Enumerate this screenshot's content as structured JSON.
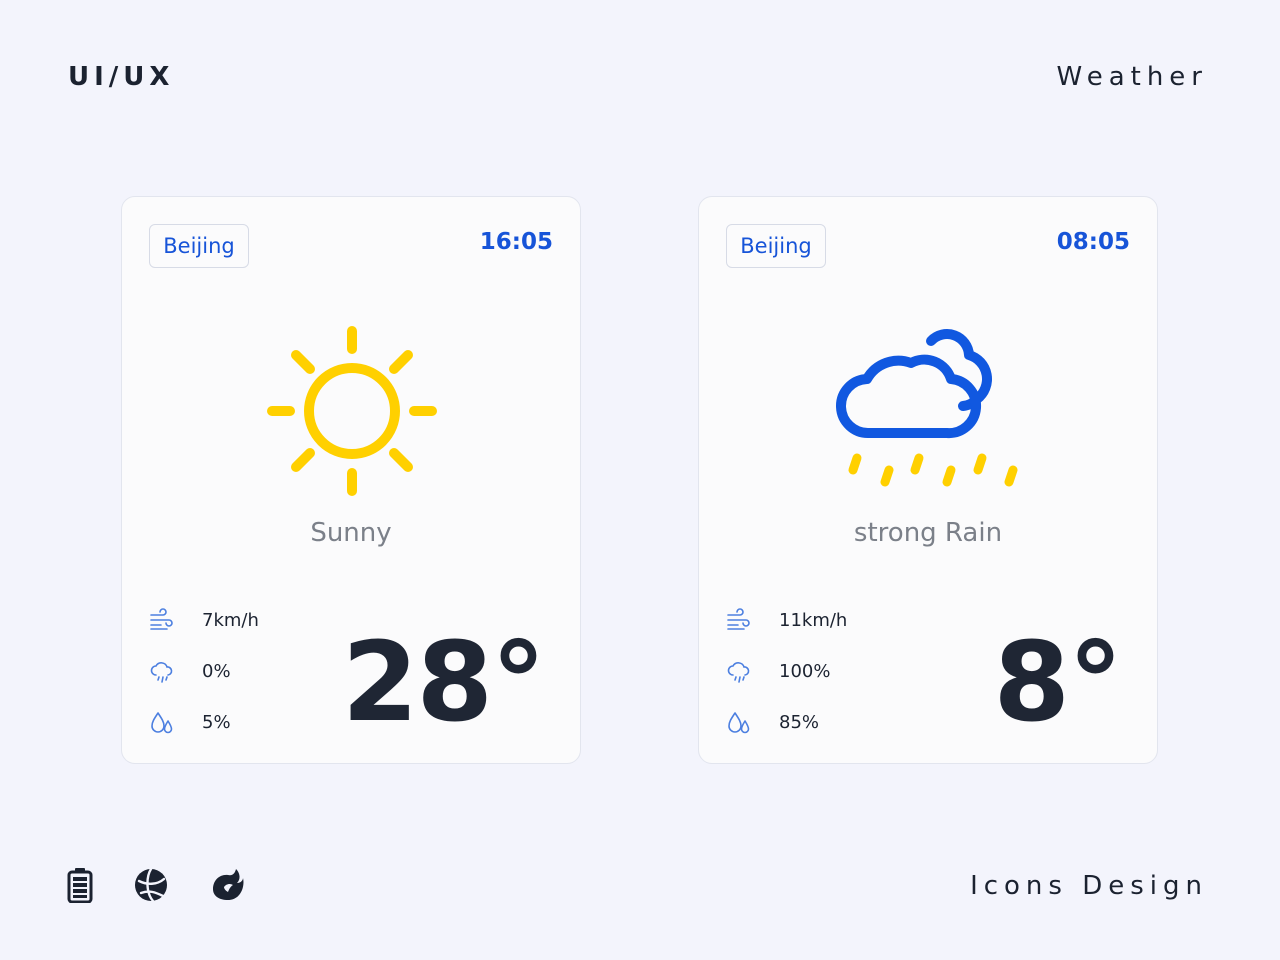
{
  "header": {
    "left_label": "UI/UX",
    "right_label": "Weather"
  },
  "footer": {
    "right_label": "Icons Design",
    "icons": [
      "battery-icon",
      "globe-icon",
      "flame-icon"
    ]
  },
  "cards": [
    {
      "city": "Beijing",
      "time": "16:05",
      "condition": "Sunny",
      "condition_icon": "sun-icon",
      "wind": "7km/h",
      "precipitation": "0%",
      "humidity": "5%",
      "temperature": "28°"
    },
    {
      "city": "Beijing",
      "time": "08:05",
      "condition": "strong Rain",
      "condition_icon": "rain-cloud-icon",
      "wind": "11km/h",
      "precipitation": "100%",
      "humidity": "85%",
      "temperature": "8°"
    }
  ],
  "colors": {
    "background": "#f3f4fc",
    "accent_blue": "#1754d8",
    "sun_yellow": "#ffd000",
    "text_dark": "#1f2634",
    "text_muted": "#7b8089"
  }
}
